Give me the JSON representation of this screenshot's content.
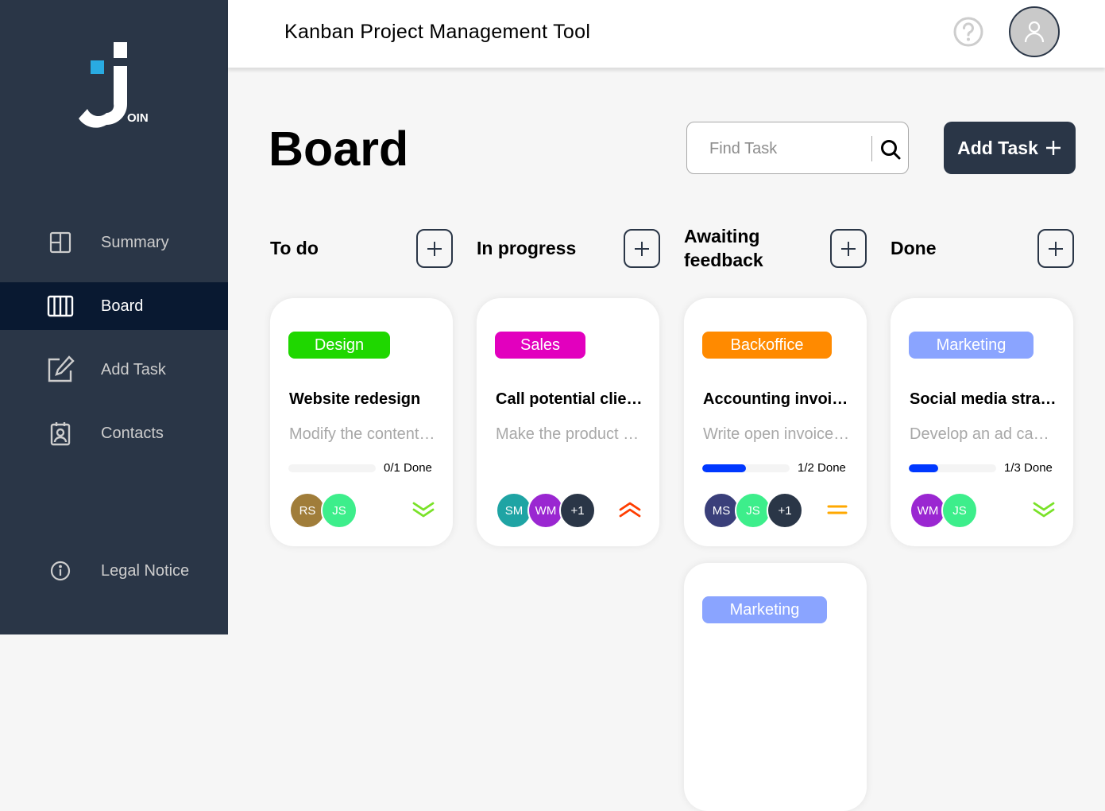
{
  "sidebar": {
    "logo_text": "OIN",
    "items": [
      {
        "label": "Summary",
        "icon": "summary-icon"
      },
      {
        "label": "Board",
        "icon": "board-icon",
        "active": true
      },
      {
        "label": "Add Task",
        "icon": "add-task-icon"
      },
      {
        "label": "Contacts",
        "icon": "contacts-icon"
      }
    ],
    "legal": {
      "label": "Legal Notice",
      "icon": "info-icon"
    }
  },
  "header": {
    "title": "Kanban Project Management Tool",
    "help_icon": "help-icon",
    "avatar_icon": "user-icon"
  },
  "board": {
    "title": "Board",
    "search": {
      "placeholder": "Find Task",
      "value": ""
    },
    "add_task_label": "Add Task"
  },
  "columns": [
    {
      "title": "To do"
    },
    {
      "title": "In progress"
    },
    {
      "title": "Awaiting feedback"
    },
    {
      "title": "Done"
    }
  ],
  "cards": [
    {
      "tag": "Design",
      "tag_color": "#1fd700",
      "title": "Website redesign",
      "desc": "Modify the contents of the main website...",
      "progress": 0,
      "progress_text": "0/1 Done",
      "assignees": [
        {
          "initials": "RS",
          "color": "#a07d3a"
        },
        {
          "initials": "JS",
          "color": "#3dee8b"
        }
      ],
      "priority": "low"
    },
    {
      "tag": "Sales",
      "tag_color": "#e200be",
      "title": "Call potential clients",
      "desc": "Make the product presentation to prospective buyers",
      "progress": null,
      "progress_text": "",
      "assignees": [
        {
          "initials": "SM",
          "color": "#1fa4a4"
        },
        {
          "initials": "WM",
          "color": "#9a27d1"
        },
        {
          "initials": "+1",
          "color": "#2a3647"
        }
      ],
      "priority": "urgent"
    },
    {
      "tag": "Backoffice",
      "tag_color": "#ff8a00",
      "title": "Accounting invoices",
      "desc": "Write open invoices for customer",
      "progress": 0.5,
      "progress_text": "1/2 Done",
      "assignees": [
        {
          "initials": "MS",
          "color": "#3a3f7a"
        },
        {
          "initials": "JS",
          "color": "#3dee8b"
        },
        {
          "initials": "+1",
          "color": "#2a3647"
        }
      ],
      "priority": "medium"
    },
    {
      "tag": "Marketing",
      "tag_color": "#8aa4ff",
      "title": "Social media strategy",
      "desc": "Develop an ad campaign for brand positioning",
      "progress": 0.333,
      "progress_text": "1/3 Done",
      "assignees": [
        {
          "initials": "WM",
          "color": "#9a27d1"
        },
        {
          "initials": "JS",
          "color": "#3dee8b"
        }
      ],
      "priority": "low"
    },
    {
      "tag": "Marketing",
      "tag_color": "#8aa4ff"
    }
  ],
  "colors": {
    "sidebar": "#2a3647",
    "active_nav": "#091931",
    "progress": "#0038ff",
    "priority_low": "#7ae229",
    "priority_medium": "#ffa800",
    "priority_urgent": "#ff3d00"
  }
}
